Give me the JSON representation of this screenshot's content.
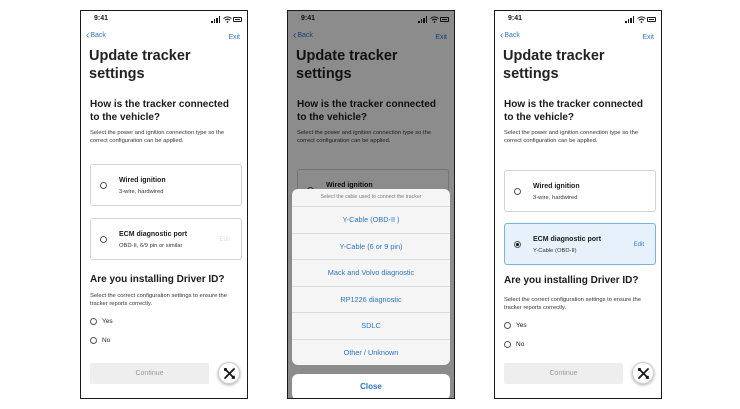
{
  "status_time": "9:41",
  "nav": {
    "back_label": "Back",
    "exit_label": "Exit"
  },
  "page_title": "Update tracker settings",
  "connection": {
    "question": "How is the tracker connected to the vehicle?",
    "hint": "Select the power and ignition connection type so the correct configuration can be applied."
  },
  "options": [
    {
      "title": "Wired ignition",
      "subtitle": "3-wire, hardwired"
    },
    {
      "title": "ECM diagnostic port",
      "subtitle": "OBD-II, 6/9 pin or similar",
      "subtitle_selected": "Y-Cable (OBD-II)",
      "edit_label": "Edit"
    }
  ],
  "driver_id": {
    "question": "Are you installing Driver ID?",
    "hint": "Select the correct configuration settings to ensure the tracker reports correctly.",
    "yes_label": "Yes",
    "no_label": "No"
  },
  "continue_label": "Continue",
  "cable_sheet": {
    "title": "Select the cable used to connect the tracker",
    "items": [
      "Y-Cable (OBD-II )",
      "Y-Cable (6 or 9 pin)",
      "Mack and Volvo diagnostic",
      "RP1226 diagnostic",
      "SDLC",
      "Other / Unknown"
    ],
    "close_label": "Close"
  },
  "colors": {
    "accent": "#2b76c8",
    "selected_card_bg": "#e6f1fb",
    "overlay": "#000000"
  },
  "icons": {
    "back": "chevron-left-icon",
    "fab": "tools-icon"
  }
}
